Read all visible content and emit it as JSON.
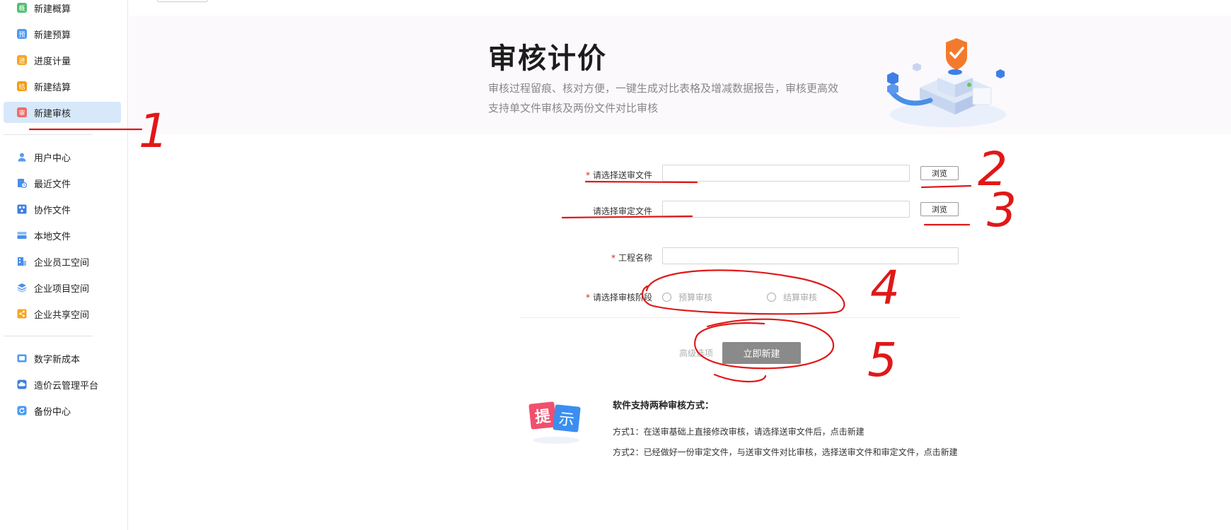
{
  "sidebar": {
    "items": [
      {
        "label": "新建概算",
        "icon": "estimate-icon",
        "icon_char": "概",
        "color": "#4fbf73"
      },
      {
        "label": "新建预算",
        "icon": "budget-icon",
        "icon_char": "预",
        "color": "#4a9af5"
      },
      {
        "label": "进度计量",
        "icon": "progress-icon",
        "icon_char": "进",
        "color": "#f5a623"
      },
      {
        "label": "新建结算",
        "icon": "settlement-icon",
        "icon_char": "结",
        "color": "#f39c12"
      },
      {
        "label": "新建审核",
        "icon": "audit-icon",
        "icon_char": "审",
        "color": "#f06a6a"
      },
      {
        "label": "用户中心",
        "icon": "user-icon",
        "icon_char": "",
        "color": "#5a9bf0"
      },
      {
        "label": "最近文件",
        "icon": "recent-file-icon",
        "icon_char": "",
        "color": "#4a8fe8"
      },
      {
        "label": "协作文件",
        "icon": "collab-file-icon",
        "icon_char": "",
        "color": "#3f7fe0"
      },
      {
        "label": "本地文件",
        "icon": "local-file-icon",
        "icon_char": "",
        "color": "#5aa0f5"
      },
      {
        "label": "企业员工空间",
        "icon": "staff-space-icon",
        "icon_char": "",
        "color": "#4a8fe8"
      },
      {
        "label": "企业项目空间",
        "icon": "project-space-icon",
        "icon_char": "",
        "color": "#4a8fe8"
      },
      {
        "label": "企业共享空间",
        "icon": "share-space-icon",
        "icon_char": "",
        "color": "#f5a623"
      },
      {
        "label": "数字新成本",
        "icon": "digital-cost-icon",
        "icon_char": "",
        "color": "#4a9af5"
      },
      {
        "label": "造价云管理平台",
        "icon": "cloud-platform-icon",
        "icon_char": "",
        "color": "#3f7fe0"
      },
      {
        "label": "备份中心",
        "icon": "backup-icon",
        "icon_char": "",
        "color": "#4a9af5"
      }
    ]
  },
  "banner": {
    "title": "审核计价",
    "desc_line1": "审核过程留痕、核对方便，一键生成对比表格及增减数据报告，审核更高效",
    "desc_line2": "支持单文件审核及两份文件对比审核"
  },
  "form": {
    "submitted_file_label": "请选择送审文件",
    "approved_file_label": "请选择审定文件",
    "project_name_label": "工程名称",
    "stage_label": "请选择审核阶段",
    "browse_label": "浏览",
    "stage_option_budget": "预算审核",
    "stage_option_settlement": "结算审核",
    "required_mark": "*",
    "submitted_file_value": "",
    "approved_file_value": "",
    "project_name_value": "",
    "advanced_label": "高级选项",
    "create_label": "立即新建"
  },
  "tip": {
    "badge_char1": "提",
    "badge_char2": "示",
    "title": "软件支持两种审核方式：",
    "line1": "方式1：在送审基础上直接修改审核，请选择送审文件后，点击新建",
    "line2": "方式2：已经做好一份审定文件，与送审文件对比审核，选择送审文件和审定文件，点击新建"
  },
  "annotations": {
    "n1": "1",
    "n2": "2",
    "n3": "3",
    "n4": "4",
    "n5": "5",
    "color": "#e01818"
  }
}
